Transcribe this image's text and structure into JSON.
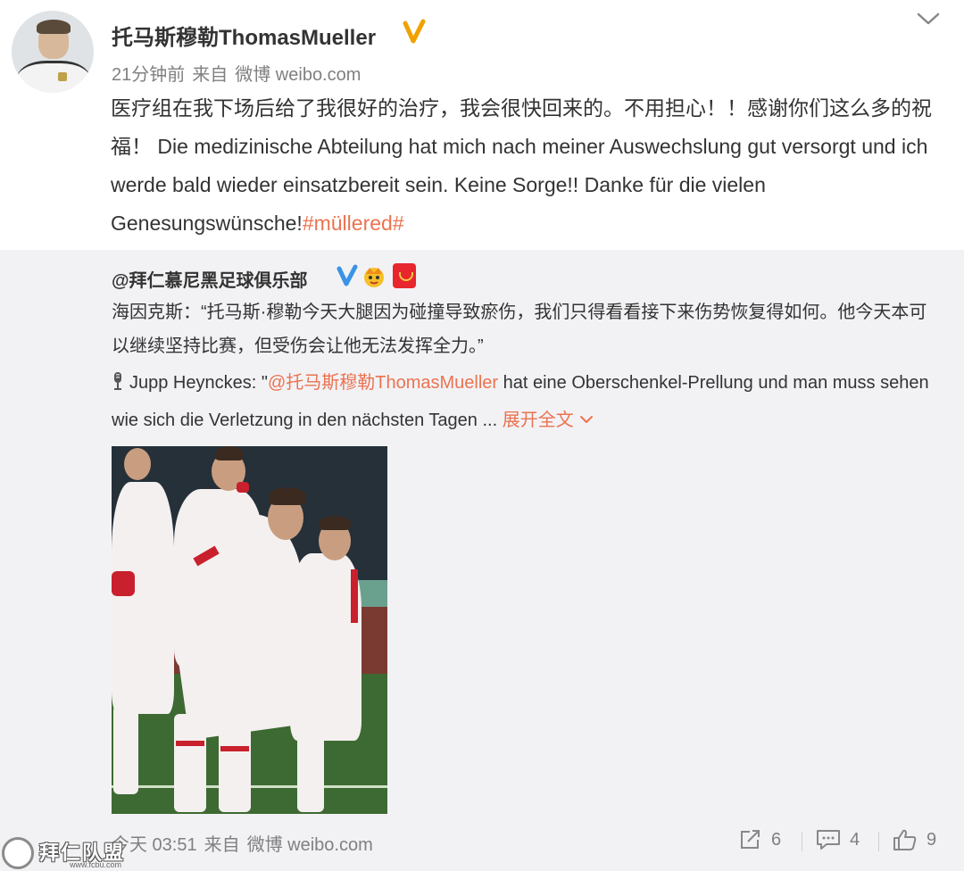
{
  "post": {
    "author": "托马斯穆勒ThomasMueller",
    "time": "21分钟前",
    "via_label": "来自",
    "via_app": "微博 weibo.com",
    "text_main": "医疗组在我下场后给了我很好的治疗，我会很快回来的。不用担心！！感谢你们这么多的祝福！ Die medizinische Abteilung hat mich nach meiner Auswechslung gut versorgt und ich werde bald wieder einsatzbereit sein. Keine Sorge!! Danke für die vielen Genesungswünsche!",
    "hashtag": "#müllered#"
  },
  "repost": {
    "author": "@拜仁慕尼黑足球俱乐部",
    "text_cn": "海因克斯：“托马斯·穆勒今天大腿因为碰撞导致瘀伤，我们只得看看接下来伤势恢复得如何。他今天本可以继续坚持比赛，但受伤会让他无法发挥全力。”",
    "text_de_prefix": "Jupp Heynckes: \"",
    "mention": "@托马斯穆勒ThomasMueller",
    "text_de_rest": " hat eine Oberschenkel-Prellung und man muss sehen wie sich die Verletzung in den nächsten Tagen ... ",
    "expand_label": "展开全文",
    "time": "今天 03:51",
    "via_label": "来自",
    "via_app": "微博 weibo.com",
    "share_count": "6",
    "comment_count": "4",
    "like_count": "9"
  },
  "watermark": {
    "text": "拜仁队盟",
    "url": "www.fcbu.com"
  },
  "colors": {
    "accent": "#eb7350",
    "verified": "#f0a100",
    "verified_blue": "#3b93e6",
    "muted": "#808080",
    "repost_bg": "#f2f2f5"
  },
  "icons": {
    "verified": "verified-v-icon",
    "dropdown": "chevron-down-icon",
    "share": "share-icon",
    "comment": "comment-icon",
    "like": "thumbs-up-icon",
    "mic": "microphone-icon"
  }
}
